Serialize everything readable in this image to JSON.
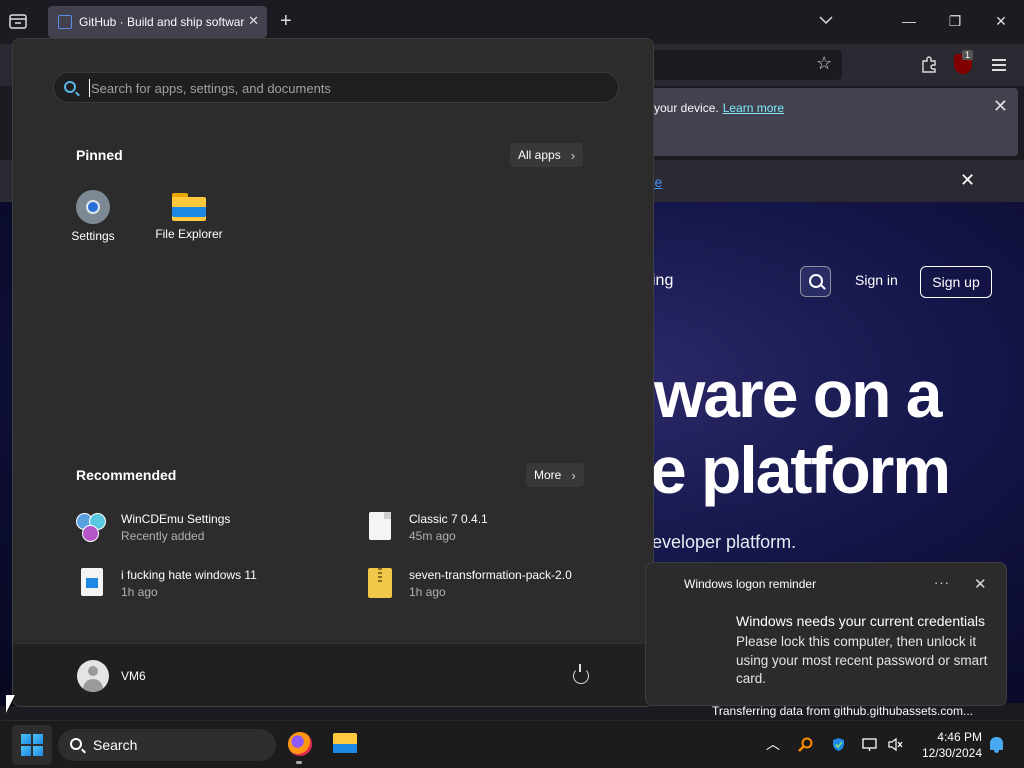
{
  "browser": {
    "tab_title": "GitHub · Build and ship software",
    "notice_text": "your device.",
    "notice_link": "Learn more",
    "extension_badge": "1",
    "status_text": "Transferring data from github.githubassets.com..."
  },
  "webpage": {
    "banner_link_fragment": "ore",
    "nav_fragment": "ing",
    "sign_in": "Sign in",
    "sign_up": "Sign up",
    "hero_line1": "ware on a",
    "hero_line2": "e platform",
    "hero_sub": "eveloper platform."
  },
  "start_menu": {
    "search_placeholder": "Search for apps, settings, and documents",
    "pinned_title": "Pinned",
    "all_apps_label": "All apps",
    "pinned": [
      {
        "label": "Settings",
        "icon": "settings-gear-icon"
      },
      {
        "label": "File Explorer",
        "icon": "folder-icon"
      }
    ],
    "recommended_title": "Recommended",
    "more_label": "More",
    "recommended": [
      {
        "name": "WinCDEmu Settings",
        "sub": "Recently added",
        "icon": "discs-icon"
      },
      {
        "name": "Classic 7 0.4.1",
        "sub": "45m ago",
        "icon": "document-icon"
      },
      {
        "name": "i fucking hate windows 11",
        "sub": "1h ago",
        "icon": "image-file-icon"
      },
      {
        "name": "seven-transformation-pack-2.0",
        "sub": "1h ago",
        "icon": "zip-folder-icon"
      }
    ],
    "user_name": "VM6"
  },
  "toast": {
    "app_name": "Windows logon reminder",
    "more": "···",
    "title": "Windows needs your current credentials",
    "body": "Please lock this computer, then unlock it using your most recent password or smart card."
  },
  "taskbar": {
    "search_label": "Search",
    "time": "4:46 PM",
    "date": "12/30/2024"
  }
}
